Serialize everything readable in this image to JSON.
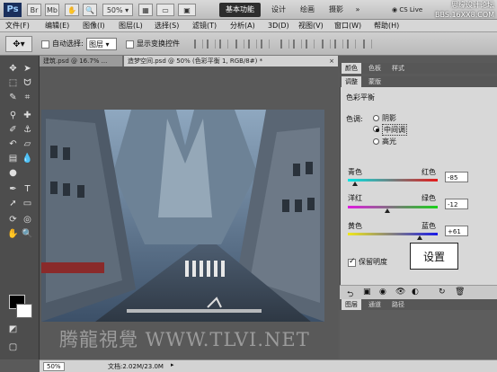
{
  "titlebar": {
    "logo": "Ps",
    "zoom": "50%",
    "workspaces": [
      "基本功能",
      "设计",
      "绘画",
      "摄影"
    ],
    "more": "»",
    "cslive": "CS Live",
    "watermark": "思缘设计论坛 BBS.16XX8.COM"
  },
  "menu": [
    "文件(F)",
    "编辑(E)",
    "图像(I)",
    "图层(L)",
    "选择(S)",
    "滤镜(T)",
    "分析(A)",
    "3D(D)",
    "视图(V)",
    "窗口(W)",
    "帮助(H)"
  ],
  "options": {
    "auto_select_label": "自动选择:",
    "auto_select_value": "图层",
    "show_transform_label": "显示变换控件"
  },
  "tabs": [
    {
      "label": "建筑.psd @ 16.7% ..."
    },
    {
      "label": "造梦空间.psd @ 50% (色彩平衡 1, RGB/8#) *"
    }
  ],
  "panel": {
    "top_tabs": [
      "颜色",
      "色板",
      "样式"
    ],
    "adj_tabs": [
      "调整",
      "蒙版"
    ],
    "title": "色彩平衡",
    "tone_label": "色调:",
    "tones": [
      "阴影",
      "中间调",
      "高光"
    ],
    "tone_selected": "中间调",
    "sliders": [
      {
        "left": "青色",
        "right": "红色",
        "value": "-85"
      },
      {
        "left": "洋红",
        "right": "绿色",
        "value": "-12"
      },
      {
        "left": "黄色",
        "right": "蓝色",
        "value": "+61"
      }
    ],
    "preserve_label": "保留明度",
    "bottom_tabs": [
      "图层",
      "通道",
      "路径"
    ]
  },
  "callout": "设置",
  "status": {
    "zoom": "50%",
    "doc": "文档:2.02M/23.0M"
  },
  "watermark_bottom": "腾龍視覺 WWW.TLVI.NET",
  "colors": {
    "accent": "#2d2d2d",
    "panel": "#d8d8d8",
    "toolbox": "#4d4d4d"
  }
}
